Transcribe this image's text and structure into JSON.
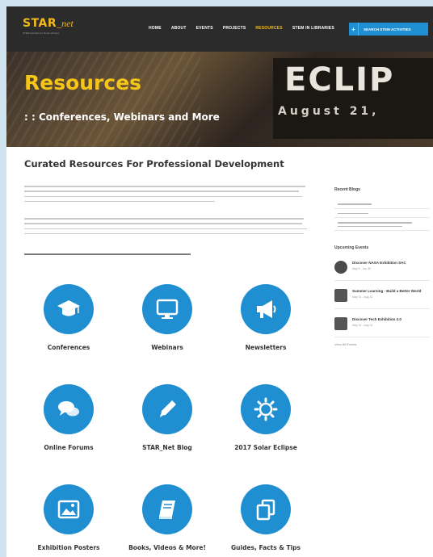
{
  "logo": {
    "star": "STAR",
    "net": "_net",
    "tagline": "STEM Activities for Rural Libraries"
  },
  "nav": {
    "items": [
      "HOME",
      "ABOUT",
      "EVENTS",
      "PROJECTS",
      "RESOURCES",
      "STEM IN LIBRARIES"
    ],
    "active": "RESOURCES",
    "cta_label": "SEARCH STEM ACTIVITIES",
    "cta_icon": "plus"
  },
  "hero": {
    "title": "Resources",
    "subtitle": ": : Conferences, Webinars and More",
    "sign_text": "ECLIP",
    "sign_date": "August 21,"
  },
  "main": {
    "title": "Curated Resources For Professional Development"
  },
  "tiles": [
    {
      "label": "Conferences",
      "icon": "graduation-cap-icon"
    },
    {
      "label": "Webinars",
      "icon": "monitor-icon"
    },
    {
      "label": "Newsletters",
      "icon": "megaphone-icon"
    },
    {
      "label": "Online Forums",
      "icon": "chat-bubbles-icon"
    },
    {
      "label": "STAR_Net Blog",
      "icon": "pencil-icon"
    },
    {
      "label": "2017 Solar Eclipse",
      "icon": "sun-icon"
    },
    {
      "label": "Exhibition Posters",
      "icon": "image-icon"
    },
    {
      "label": "Books, Videos & More!",
      "icon": "book-icon"
    },
    {
      "label": "Guides, Facts & Tips",
      "icon": "copy-icon"
    }
  ],
  "sidebar": {
    "recent_blogs_heading": "Recent Blogs",
    "events_heading": "Upcoming Events",
    "events": [
      {
        "title": "Discover NASA Exhibition SAC",
        "date": "May 5 - Jun 30"
      },
      {
        "title": "Summer Learning - Build a Better World",
        "date": "May 31 - Aug 31"
      },
      {
        "title": "Discover Tech Exhibition 2.0",
        "date": "May 31 - Aug 31"
      }
    ],
    "view_all": "View All Events"
  },
  "colors": {
    "accent_blue": "#1f8fd1",
    "brand_gold": "#f5b91a",
    "header_dark": "#2b2b2b"
  }
}
